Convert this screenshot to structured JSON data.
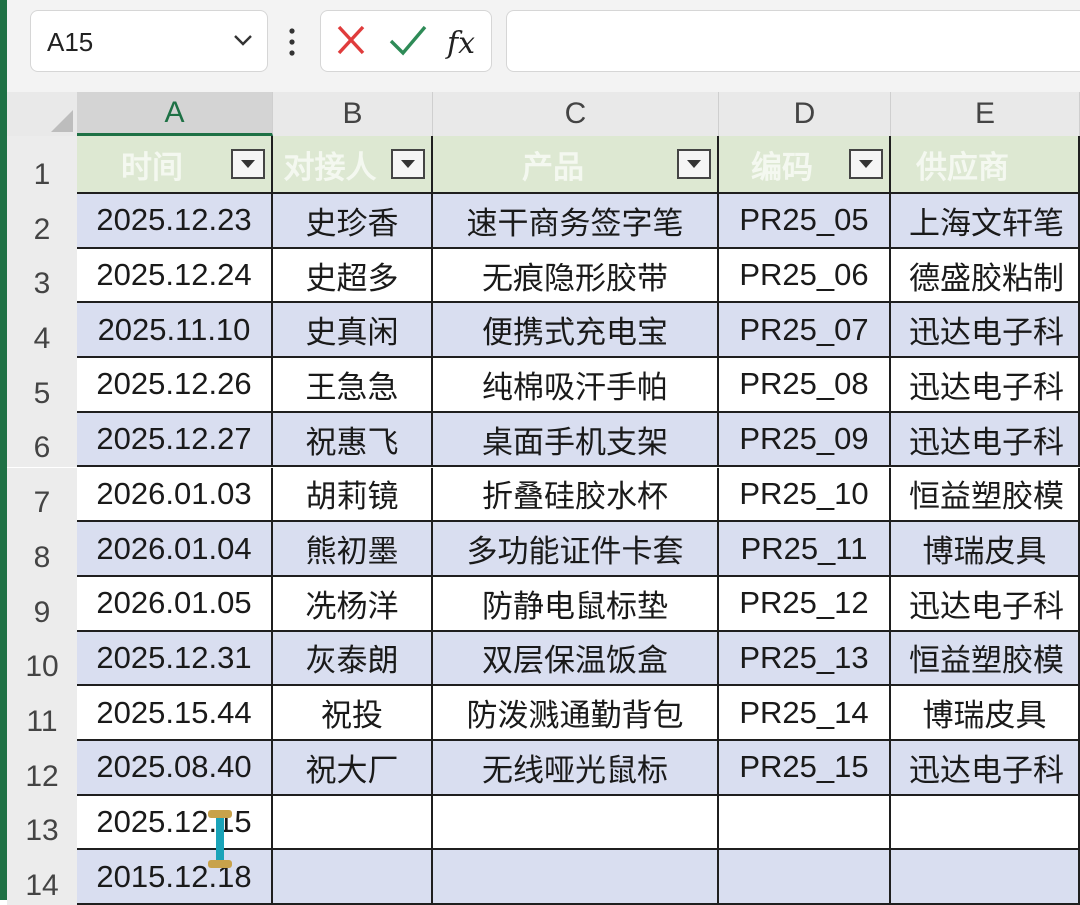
{
  "formula_bar": {
    "name_box": "A15",
    "formula_value": "",
    "icons": {
      "cancel": "close-icon",
      "confirm": "check-icon",
      "function": "function-icon"
    },
    "colors": {
      "cancel": "#e03c3c",
      "confirm": "#2e8b57"
    }
  },
  "sheet": {
    "columns": [
      "A",
      "B",
      "C",
      "D",
      "E"
    ],
    "rows": [
      "1",
      "2",
      "3",
      "4",
      "5",
      "6",
      "7",
      "8",
      "9",
      "10",
      "11",
      "12",
      "13",
      "14"
    ],
    "active_column": "A",
    "table_headers": [
      "时间",
      "对接人",
      "产品",
      "编码",
      "供应商"
    ],
    "table_rows": [
      [
        "2025.12.23",
        "史珍香",
        "速干商务签字笔",
        "PR25_05",
        "上海文轩笔"
      ],
      [
        "2025.12.24",
        "史超多",
        "无痕隐形胶带",
        "PR25_06",
        "德盛胶粘制"
      ],
      [
        "2025.11.10",
        "史真闲",
        "便携式充电宝",
        "PR25_07",
        "迅达电子科"
      ],
      [
        "2025.12.26",
        "王急急",
        "纯棉吸汗手帕",
        "PR25_08",
        "迅达电子科"
      ],
      [
        "2025.12.27",
        "祝惠飞",
        "桌面手机支架",
        "PR25_09",
        "迅达电子科"
      ],
      [
        "2026.01.03",
        "胡莉镜",
        "折叠硅胶水杯",
        "PR25_10",
        "恒益塑胶模"
      ],
      [
        "2026.01.04",
        "熊初墨",
        "多功能证件卡套",
        "PR25_11",
        "博瑞皮具"
      ],
      [
        "2026.01.05",
        "冼杨洋",
        "防静电鼠标垫",
        "PR25_12",
        "迅达电子科"
      ],
      [
        "2025.12.31",
        "灰泰朗",
        "双层保温饭盒",
        "PR25_13",
        "恒益塑胶模"
      ],
      [
        "2025.15.44",
        "祝投",
        "防泼溅通勤背包",
        "PR25_14",
        "博瑞皮具"
      ],
      [
        "2025.08.40",
        "祝大厂",
        "无线哑光鼠标",
        "PR25_15",
        "迅达电子科"
      ],
      [
        "2025.12.15",
        "",
        "",
        "",
        ""
      ],
      [
        "2015.12.18",
        "",
        "",
        "",
        ""
      ]
    ],
    "colors": {
      "header_fill": "#dde8d2",
      "band_fill": "#d9def0",
      "accent": "#1e7145"
    }
  }
}
